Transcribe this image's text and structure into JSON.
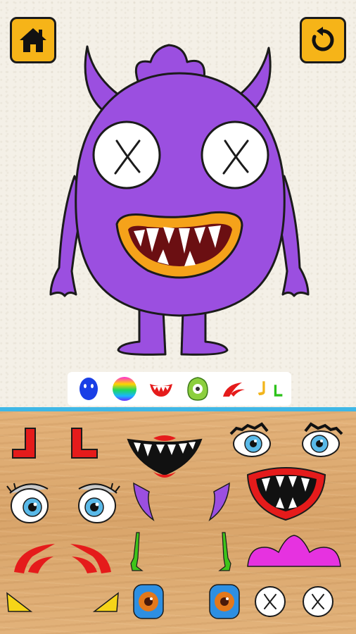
{
  "toolbar": {
    "home_icon": "home-icon",
    "reset_icon": "reset-icon"
  },
  "colors": {
    "accent_button": "#f6b418",
    "monster_body": "#9b4fe0",
    "monster_outline": "#1b1b1b",
    "divider": "#3fb7e6",
    "tray_wood": "#dcab73"
  },
  "categories": [
    {
      "name": "body-shape"
    },
    {
      "name": "body-color"
    },
    {
      "name": "mouths"
    },
    {
      "name": "eyes"
    },
    {
      "name": "eyebrows"
    },
    {
      "name": "legs-arms"
    }
  ],
  "parts": [
    "red-boot-left",
    "red-boot-right",
    "black-mouth-red-lips",
    "blue-eyes-lashes",
    "blue-eye-left-lashes",
    "blue-eye-right-lashes",
    "purple-horn-left",
    "purple-horn-right",
    "red-mouth-open",
    "red-eyebrow-left",
    "red-eyebrow-right",
    "green-arm-left",
    "green-arm-right",
    "pink-crown",
    "yellow-horn-left",
    "yellow-horn-right",
    "blue-square-eye-left",
    "blue-square-eye-right",
    "x-eye-left",
    "x-eye-right"
  ]
}
